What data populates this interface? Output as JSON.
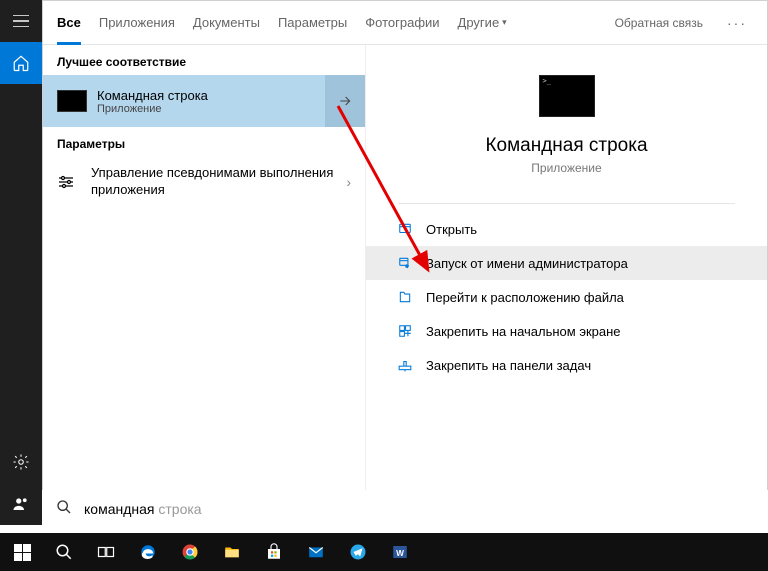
{
  "rail": {
    "menu": "menu",
    "home": "home",
    "gear": "gear",
    "people": "people"
  },
  "tabs": {
    "all": "Все",
    "apps": "Приложения",
    "docs": "Документы",
    "settings": "Параметры",
    "photos": "Фотографии",
    "other": "Другие",
    "feedback": "Обратная связь"
  },
  "sections": {
    "best": "Лучшее соответствие",
    "params": "Параметры"
  },
  "best": {
    "title": "Командная строка",
    "subtitle": "Приложение"
  },
  "param_item": {
    "title": "Управление псевдонимами выполнения приложения"
  },
  "preview": {
    "title": "Командная строка",
    "subtitle": "Приложение",
    "actions": {
      "open": "Открыть",
      "runadmin": "Запуск от имени администратора",
      "location": "Перейти к расположению файла",
      "pin_start": "Закрепить на начальном экране",
      "pin_task": "Закрепить на панели задач"
    }
  },
  "search": {
    "typed": "командная",
    "ghost": " строка"
  }
}
